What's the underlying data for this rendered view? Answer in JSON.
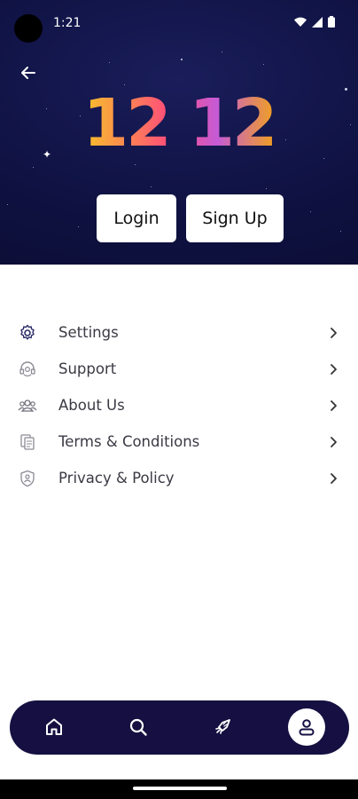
{
  "status_bar": {
    "time": "1:21"
  },
  "hero": {
    "logo_text": "12 12",
    "back_icon": "arrow-left-icon"
  },
  "auth": {
    "login_label": "Login",
    "signup_label": "Sign Up"
  },
  "menu": {
    "items": [
      {
        "label": "Settings",
        "icon": "gear-icon"
      },
      {
        "label": "Support",
        "icon": "headset-icon"
      },
      {
        "label": "About Us",
        "icon": "users-icon"
      },
      {
        "label": "Terms & Conditions",
        "icon": "document-icon"
      },
      {
        "label": "Privacy & Policy",
        "icon": "shield-icon"
      }
    ]
  },
  "bottom_nav": {
    "items": [
      {
        "icon": "home-icon",
        "active": false
      },
      {
        "icon": "search-icon",
        "active": false
      },
      {
        "icon": "rocket-icon",
        "active": false
      },
      {
        "icon": "profile-icon",
        "active": true
      }
    ]
  },
  "colors": {
    "hero_bg": "#0f1242",
    "nav_bg": "#151041",
    "text": "#3a3a44"
  }
}
